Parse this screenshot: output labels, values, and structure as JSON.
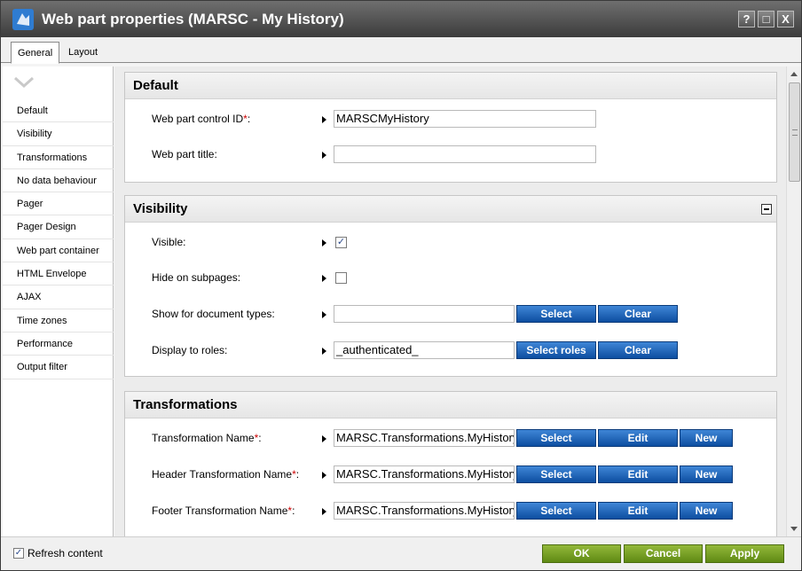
{
  "window": {
    "title": "Web part properties (MARSC - My History)",
    "buttons": [
      "?",
      "□",
      "X"
    ]
  },
  "tabs": [
    "General",
    "Layout"
  ],
  "sidebar": {
    "items": [
      "Default",
      "Visibility",
      "Transformations",
      "No data behaviour",
      "Pager",
      "Pager Design",
      "Web part container",
      "HTML Envelope",
      "AJAX",
      "Time zones",
      "Performance",
      "Output filter"
    ]
  },
  "default_section": {
    "title": "Default",
    "control_id_label": "Web part control ID",
    "control_id_value": "MARSCMyHistory",
    "title_label": "Web part title:",
    "title_value": ""
  },
  "visibility_section": {
    "title": "Visibility",
    "visible_label": "Visible:",
    "visible_checked": true,
    "hide_label": "Hide on subpages:",
    "hide_checked": false,
    "doctypes_label": "Show for document types:",
    "doctypes_value": "",
    "select_label": "Select",
    "clear_label": "Clear",
    "roles_label": "Display to roles:",
    "roles_value": "_authenticated_",
    "select_roles_label": "Select roles"
  },
  "transformations_section": {
    "title": "Transformations",
    "rows": [
      {
        "label": "Transformation Name",
        "value": "MARSC.Transformations.MyHistory"
      },
      {
        "label": "Header Transformation Name",
        "value": "MARSC.Transformations.MyHistory"
      },
      {
        "label": "Footer Transformation Name",
        "value": "MARSC.Transformations.MyHistory"
      }
    ],
    "select_label": "Select",
    "edit_label": "Edit",
    "new_label": "New"
  },
  "footer": {
    "refresh_label": "Refresh content",
    "refresh_checked": true,
    "ok_label": "OK",
    "cancel_label": "Cancel",
    "apply_label": "Apply"
  },
  "colors": {
    "title_bar": "#4a4a4a",
    "blue_button": "#1a5fb4",
    "green_button": "#6f9a1e",
    "required_star": "#cc0000"
  }
}
